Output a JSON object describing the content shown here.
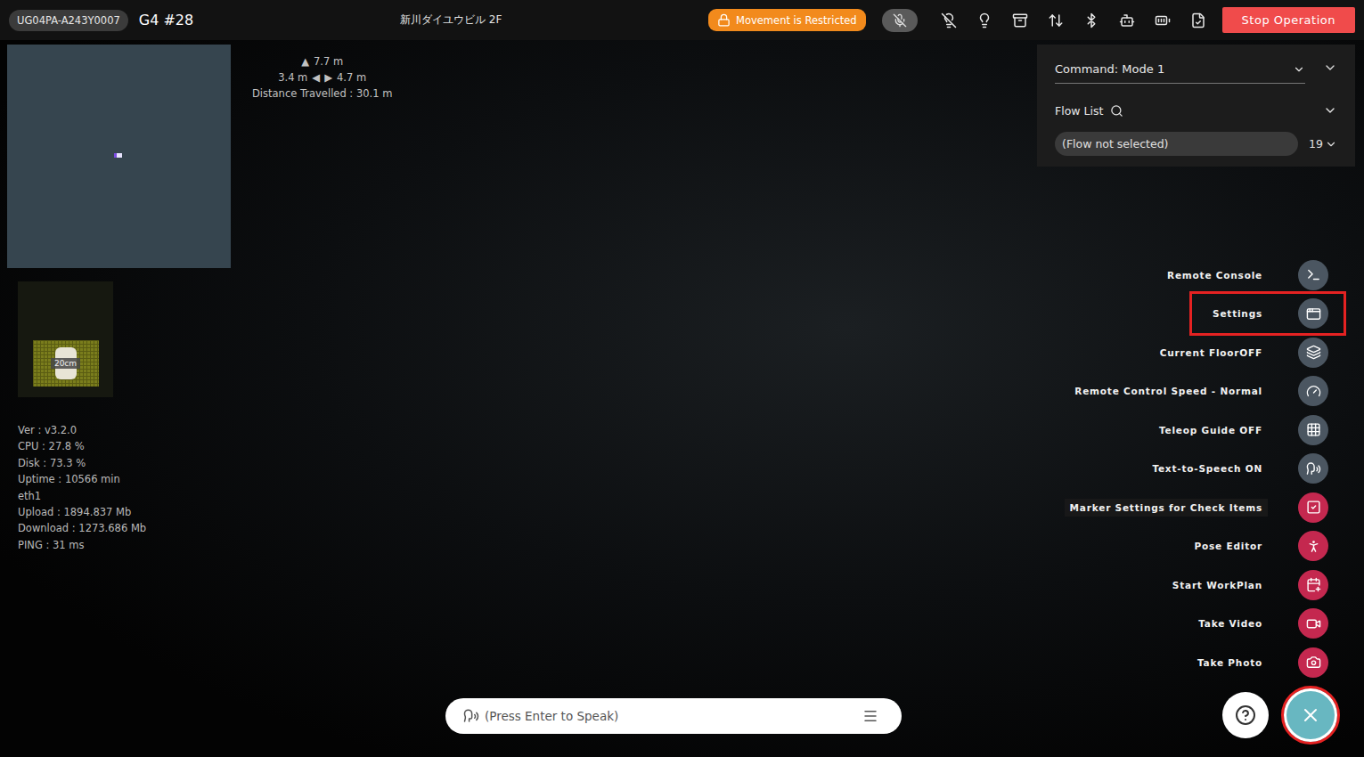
{
  "topbar": {
    "robot_id": "UG04PA-A243Y0007",
    "robot_name": "G4 #28",
    "location": "新川ダイユウビル 2F",
    "restriction": "Movement is Restricted",
    "stop_button": "Stop Operation"
  },
  "distance": {
    "arrow_up": "▲",
    "forward": "7.7 m",
    "left": "3.4 m",
    "arrow_left": "◀",
    "arrow_right": "▶",
    "right": "4.7 m",
    "travelled": "Distance Travelled : 30.1 m"
  },
  "grid_label": "20cm",
  "stats": [
    "Ver : v3.2.0",
    "CPU : 27.8 %",
    "Disk : 73.3 %",
    "Uptime : 10566 min",
    "eth1",
    "Upload : 1894.837 Mb",
    "Download : 1273.686 Mb",
    "PING : 31 ms"
  ],
  "command": {
    "label": "Command: Mode 1"
  },
  "flow_list": {
    "label": "Flow List"
  },
  "flow": {
    "value": "(Flow not selected)",
    "count": "19"
  },
  "menu": [
    {
      "label": "Remote Console",
      "color": "#4b5661",
      "highlighted": false,
      "hovered": false
    },
    {
      "label": "Settings",
      "color": "#4b5661",
      "highlighted": true,
      "hovered": false
    },
    {
      "label": "Current FloorOFF",
      "color": "#4b5661",
      "highlighted": false,
      "hovered": false
    },
    {
      "label": "Remote Control Speed - Normal",
      "color": "#4b5661",
      "highlighted": false,
      "hovered": false
    },
    {
      "label": "Teleop Guide OFF",
      "color": "#4b5661",
      "highlighted": false,
      "hovered": false
    },
    {
      "label": "Text-to-Speech ON",
      "color": "#4b5661",
      "highlighted": false,
      "hovered": false
    },
    {
      "label": "Marker Settings for Check Items",
      "color": "#c4284f",
      "highlighted": false,
      "hovered": true
    },
    {
      "label": "Pose Editor",
      "color": "#c4284f",
      "highlighted": false,
      "hovered": false
    },
    {
      "label": "Start WorkPlan",
      "color": "#c4284f",
      "highlighted": false,
      "hovered": false
    },
    {
      "label": "Take Video",
      "color": "#c4284f",
      "highlighted": false,
      "hovered": false
    },
    {
      "label": "Take Photo",
      "color": "#c4284f",
      "highlighted": false,
      "hovered": false
    }
  ],
  "speech_input": {
    "placeholder": "(Press Enter to Speak)"
  }
}
